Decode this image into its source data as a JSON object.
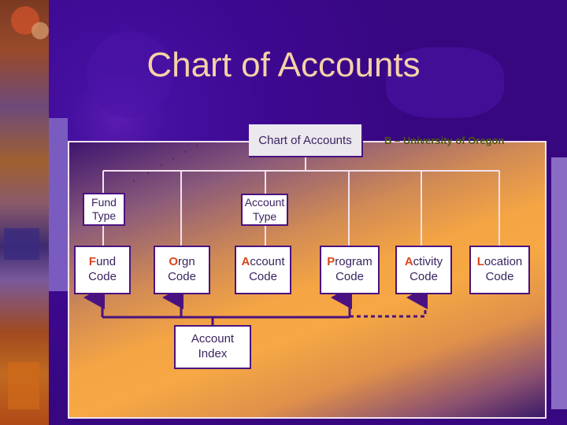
{
  "slide": {
    "title": "Chart of Accounts",
    "colors": {
      "background": "#3f0a96",
      "title_text": "#f5d2a6",
      "box_border": "#4a1280",
      "initial_letter": "#d8461c",
      "subtitle_text": "#4f5a0e",
      "connector": "#4a1280"
    }
  },
  "diagram": {
    "header": "Chart of Accounts",
    "subtitle": "B – University of Oregon",
    "types": [
      {
        "line1": "Fund",
        "line2": "Type"
      },
      {
        "line1": "Account",
        "line2": "Type"
      }
    ],
    "codes": [
      {
        "initial": "F",
        "rest": "und",
        "line2": "Code"
      },
      {
        "initial": "O",
        "rest": "rgn",
        "line2": "Code"
      },
      {
        "initial": "A",
        "rest": "ccount",
        "line2": "Code"
      },
      {
        "initial": "P",
        "rest": "rogram",
        "line2": "Code"
      },
      {
        "initial": "A",
        "rest": "ctivity",
        "line2": "Code"
      },
      {
        "initial": "L",
        "rest": "ocation",
        "line2": "Code"
      }
    ],
    "index": {
      "line1": "Account",
      "line2": "Index"
    },
    "index_links": {
      "solid": [
        "Fund Code",
        "Orgn Code",
        "Program Code"
      ],
      "dashed": [
        "Activity Code"
      ]
    }
  }
}
